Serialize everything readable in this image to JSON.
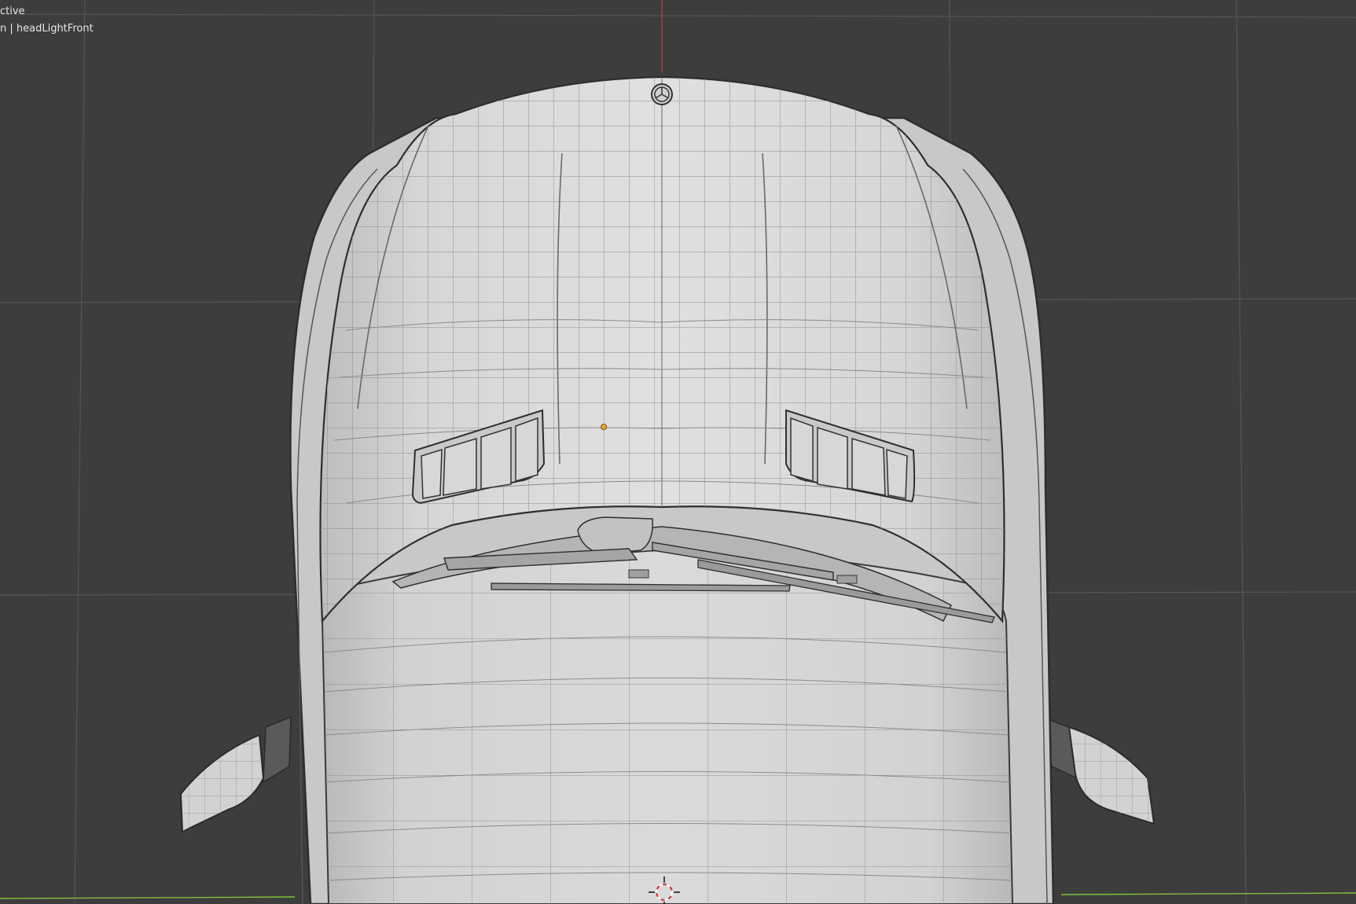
{
  "viewport": {
    "view_label": "ctive",
    "object_label": "n | headLightFront",
    "background_color": "#3d3d3d",
    "grid_color": "#555555",
    "x_axis_color": "#7fbf3f",
    "y_axis_color": "#cf3a3a",
    "mesh_fill": "#d4d4d4",
    "wire_color": "#8a8a8a",
    "origin_point_color": "#f0a030",
    "icons": [
      "3d-cursor-icon",
      "origin-point-icon",
      "brand-emblem-icon"
    ]
  }
}
